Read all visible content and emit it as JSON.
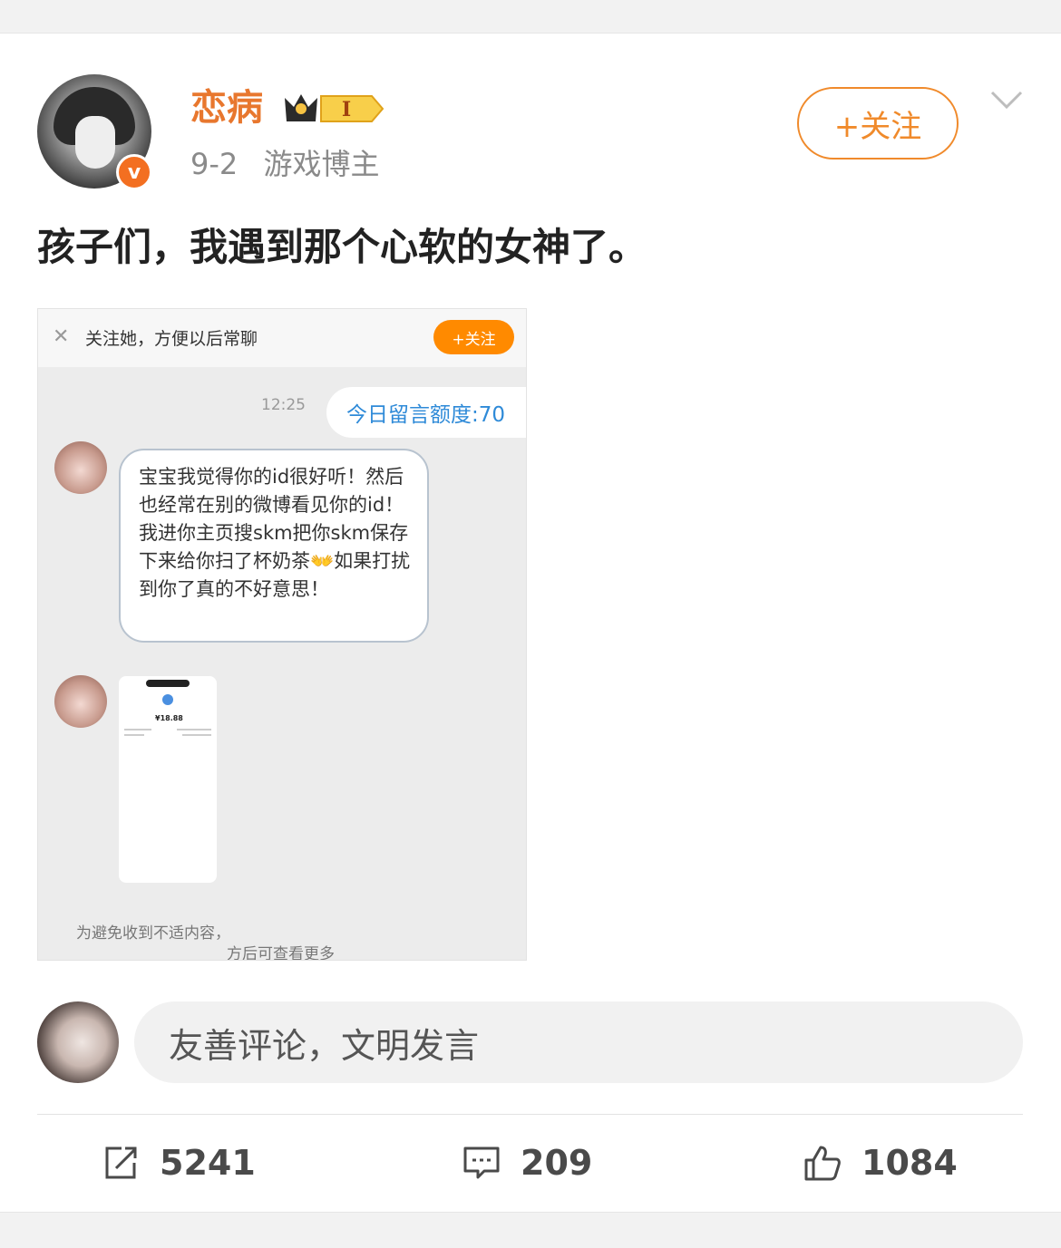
{
  "author": {
    "name": "恋病",
    "level_badge": "I",
    "date": "9-2",
    "tag": "游戏博主",
    "follow_label": "+关注"
  },
  "post": {
    "text": "孩子们，我遇到那个心软的女神了。"
  },
  "screenshot": {
    "bar_text": "关注她，方便以后常聊",
    "bar_follow": "+关注",
    "time": "12:25",
    "quota": "今日留言额度:70",
    "message": "宝宝我觉得你的id很好听！然后也经常在别的微博看见你的id！我进你主页搜skm把你skm保存下来给你扫了杯奶茶👐如果打扰到你了真的不好意思！",
    "image_amount": "¥18.88",
    "footer_line1": "为避免收到不适内容，",
    "footer_line2": "方后可查看更多"
  },
  "comment": {
    "placeholder": "友善评论，文明发言"
  },
  "actions": {
    "reposts": "5241",
    "comments": "209",
    "likes": "1084"
  },
  "colors": {
    "accent": "#f08a2b",
    "username": "#e8772e",
    "verified": "#f36f21"
  },
  "icons": [
    "verified-icon",
    "crown-badge-icon",
    "chevron-down-icon",
    "close-icon",
    "repost-icon",
    "comment-icon",
    "like-icon"
  ]
}
